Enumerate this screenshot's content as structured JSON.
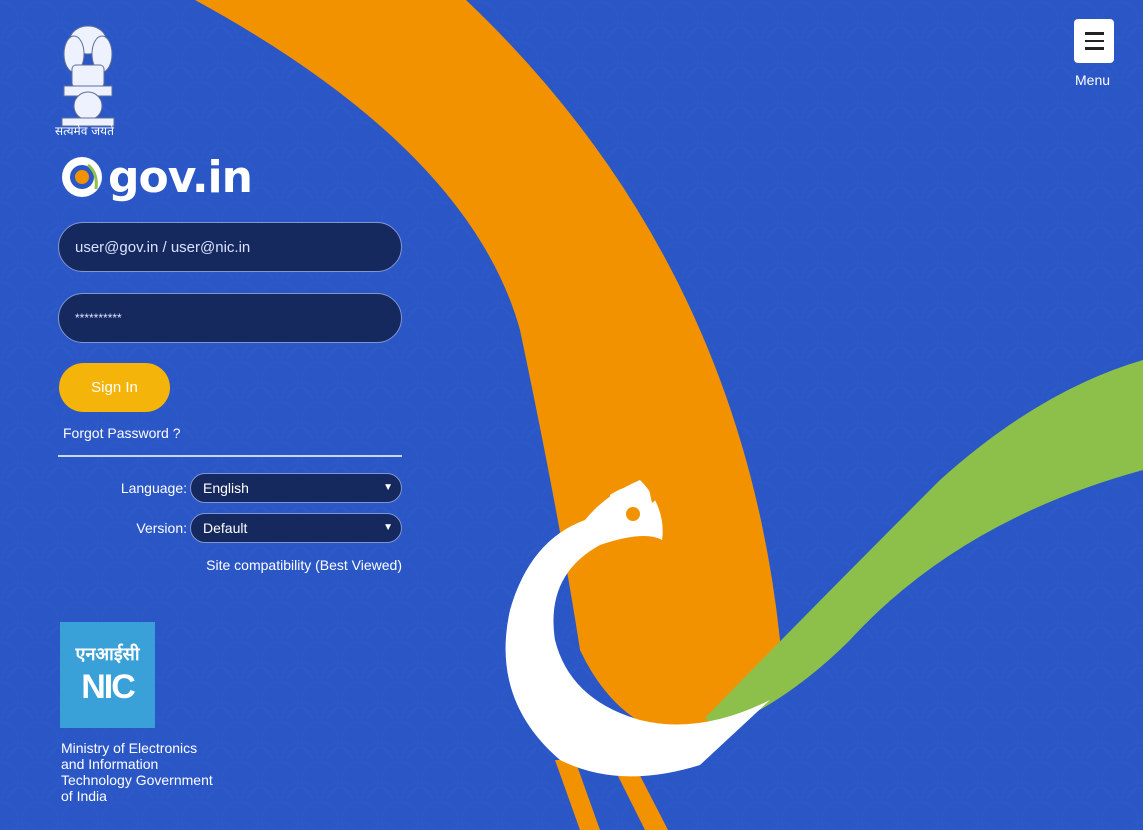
{
  "header": {
    "motto": "सत्यमेव जयते",
    "logo_text": "gov.in",
    "menu_label": "Menu"
  },
  "login": {
    "email_placeholder": "user@gov.in / user@nic.in",
    "password_masked": "**********",
    "signin_label": "Sign In",
    "forgot_label": "Forgot Password ?"
  },
  "settings": {
    "language_label": "Language:",
    "language_value": "English",
    "version_label": "Version:",
    "version_value": "Default",
    "compat_label": "Site compatibility (Best Viewed)"
  },
  "footer": {
    "nic_hindi": "एनआईसी",
    "nic_word": "NIC",
    "ministry_text": "Ministry of Electronics and Information Technology Government of India"
  },
  "colors": {
    "background": "#2a56c6",
    "orange": "#f29200",
    "green": "#8dc04a",
    "button": "#f5b40a",
    "field": "#16295e"
  }
}
